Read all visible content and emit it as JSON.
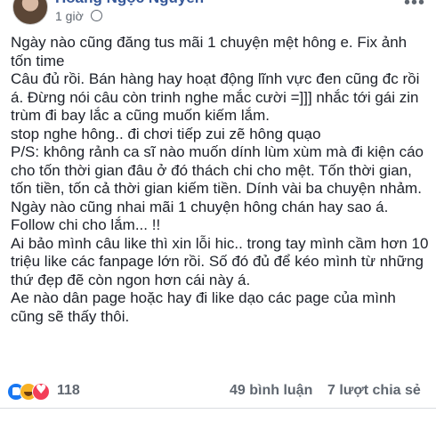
{
  "header": {
    "author": "Hoàng Ngọc Nguyễn",
    "time": "1 giờ",
    "privacy_icon": "globe-icon",
    "more_icon": "more-options-icon"
  },
  "post": {
    "paragraphs": [
      "Ngày nào cũng đăng tus mãi 1 chuyện mệt hông e. Fix ảnh tốn time",
      "Câu đủ rồi. Bán hàng hay hoạt động lĩnh vực đen cũng đc rồi á. Đừng nói câu còn trinh nghe mắc cười =]]] nhắc tới gái zin trùm đi bay lắc a cũng muốn kiếm lắm.",
      "stop nghe hông.. đi chơi tiếp zui zẽ hông quạo",
      "P/S: không rảnh ca sĩ nào muốn dính lùm xùm mà đi kiện cáo cho tốn thời gian đâu ở đó thách chi cho mệt. Tốn thời gian, tốn tiền, tốn cả thời gian kiếm tiền. Dính vài ba chuyện nhảm.",
      "Ngày nào cũng nhai mãi 1 chuyện hông chán hay sao á. Follow chi cho lắm... !!",
      "Ai bảo mình câu like thì xin lỗi hic.. trong tay mình cầm hơn 10 triệu like các fanpage lớn rồi. Số đó đủ để kéo mình từ những thứ đẹp đẽ còn ngon hơn cái này á.",
      "Ae nào dân page hoặc hay đi like dạo các page của mình cũng sẽ thấy thôi."
    ]
  },
  "footer": {
    "reaction_icons": [
      "like-icon",
      "haha-icon",
      "love-icon"
    ],
    "reaction_count": "118",
    "comments": "49 bình luận",
    "shares": "7 lượt chia sẻ"
  },
  "colors": {
    "author_link": "#365899",
    "text": "#1d2129",
    "meta": "#606770",
    "like": "#1877f2",
    "haha": "#f7b125",
    "love": "#f33e58"
  }
}
